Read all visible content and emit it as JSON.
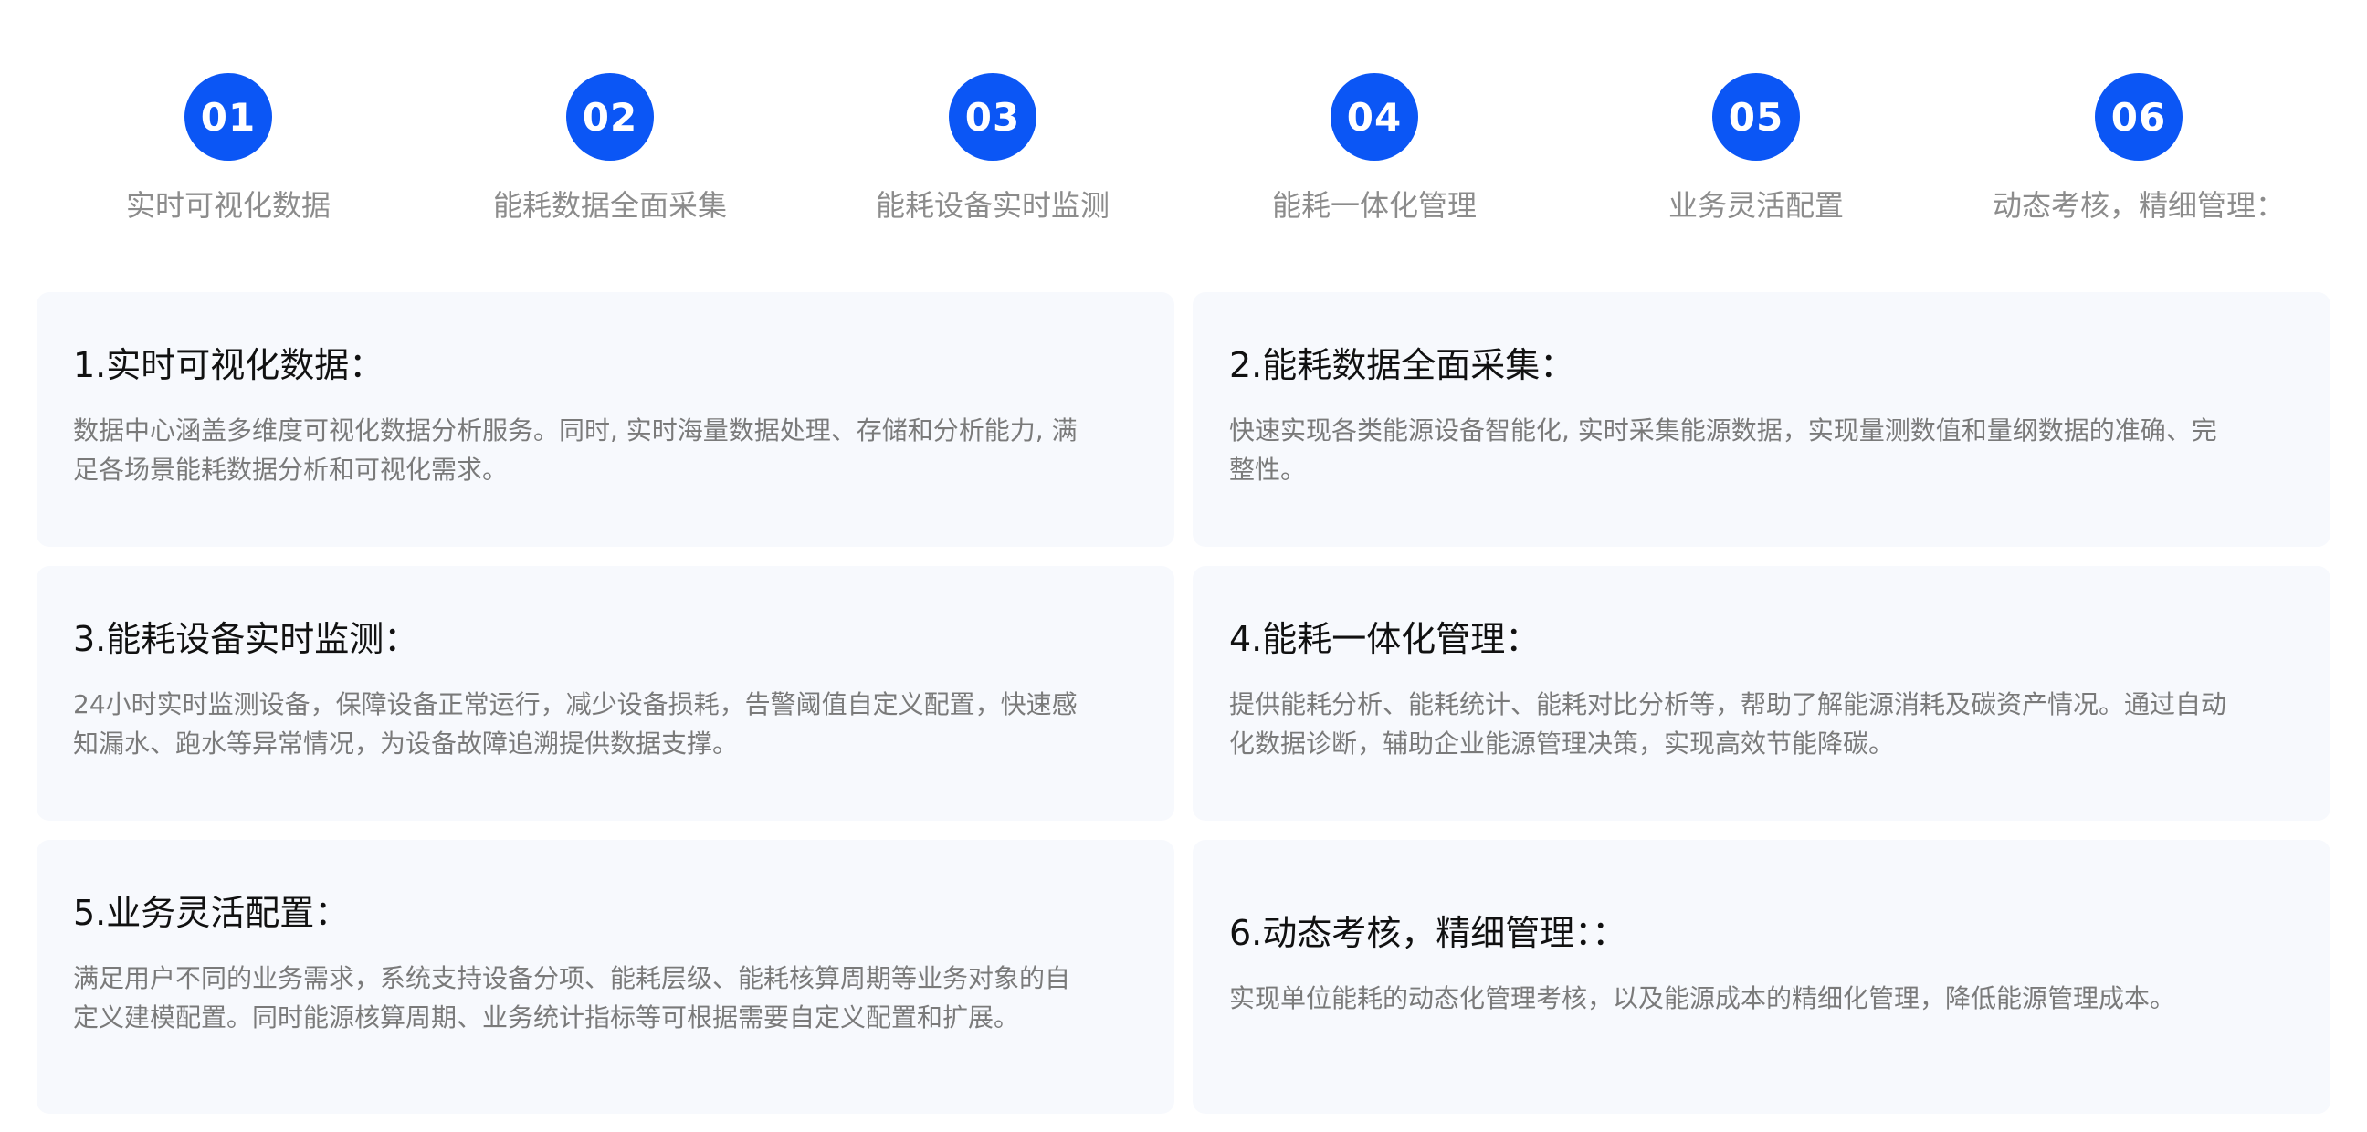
{
  "steps": [
    {
      "number": "01",
      "label": "实时可视化数据"
    },
    {
      "number": "02",
      "label": "能耗数据全面采集"
    },
    {
      "number": "03",
      "label": "能耗设备实时监测"
    },
    {
      "number": "04",
      "label": "能耗一体化管理"
    },
    {
      "number": "05",
      "label": "业务灵活配置"
    },
    {
      "number": "06",
      "label": "动态考核，精细管理："
    }
  ],
  "cards": [
    {
      "title": "1.实时可视化数据：",
      "desc": "数据中心涵盖多维度可视化数据分析服务。同时, 实时海量数据处理、存储和分析能力, 满足各场景能耗数据分析和可视化需求。"
    },
    {
      "title": "2.能耗数据全面采集：",
      "desc": "快速实现各类能源设备智能化, 实时采集能源数据，实现量测数值和量纲数据的准确、完整性。"
    },
    {
      "title": "3.能耗设备实时监测：",
      "desc": "24小时实时监测设备，保障设备正常运行，减少设备损耗，告警阈值自定义配置，快速感知漏水、跑水等异常情况，为设备故障追溯提供数据支撑。"
    },
    {
      "title": "4.能耗一体化管理：",
      "desc": "提供能耗分析、能耗统计、能耗对比分析等，帮助了解能源消耗及碳资产情况。通过自动化数据诊断，辅助企业能源管理决策，实现高效节能降碳。"
    },
    {
      "title": "5.业务灵活配置：",
      "desc": "满足用户不同的业务需求，系统支持设备分项、能耗层级、能耗核算周期等业务对象的自定义建模配置。同时能源核算周期、业务统计指标等可根据需要自定义配置和扩展。"
    },
    {
      "title": "6.动态考核，精细管理：：",
      "desc": "实现单位能耗的动态化管理考核，以及能源成本的精细化管理，降低能源管理成本。"
    }
  ],
  "colors": {
    "accent": "#0b56f5",
    "card_background": "#f7f9fd",
    "title_text": "#111111",
    "body_text": "#7a7a7a",
    "step_label_text": "#8c8c8c"
  }
}
